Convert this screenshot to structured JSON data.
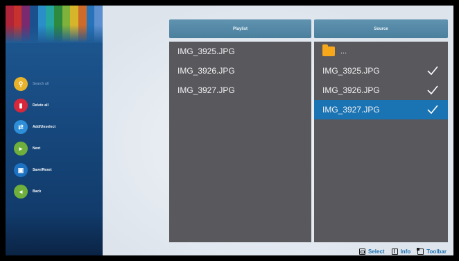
{
  "sidebar": {
    "stripe_colors": [
      "#b0243a",
      "#c8322e",
      "#7a2a6e",
      "#1b4f8d",
      "#2a8fc9",
      "#25a7a0",
      "#2d8a3e",
      "#7fb23a",
      "#d7b52b",
      "#cf6b2a",
      "#2673b9",
      "#5b8fd0"
    ],
    "items": [
      {
        "label": "Search all",
        "icon": "search-icon",
        "color": "#e8b32a",
        "dim": true
      },
      {
        "label": "Delete all",
        "icon": "delete-icon",
        "color": "#d6283a",
        "dim": false
      },
      {
        "label": "Add/Unselect",
        "icon": "add-icon",
        "color": "#2e8fd8",
        "dim": false
      },
      {
        "label": "Next",
        "icon": "next-icon",
        "color": "#6fb03c",
        "dim": false
      },
      {
        "label": "Save/Reset",
        "icon": "save-icon",
        "color": "#1e72c2",
        "dim": false
      },
      {
        "label": "Back",
        "icon": "back-icon",
        "color": "#6fb03c",
        "dim": false
      }
    ]
  },
  "playlist": {
    "header": "Playlist",
    "items": [
      "IMG_3925.JPG",
      "IMG_3926.JPG",
      "IMG_3927.JPG"
    ]
  },
  "source": {
    "header": "Source",
    "parent_label": "...",
    "items": [
      {
        "name": "IMG_3925.JPG",
        "checked": true,
        "selected": false
      },
      {
        "name": "IMG_3926.JPG",
        "checked": true,
        "selected": false
      },
      {
        "name": "IMG_3927.JPG",
        "checked": true,
        "selected": true
      }
    ]
  },
  "footer": {
    "select_label": "Select",
    "info_label": "Info",
    "toolbar_label": "Toolbar"
  },
  "colors": {
    "selected_row": "#1a73b3",
    "panel": "#58585d",
    "header": "#4a7f9d",
    "folder": "#f7a81a"
  }
}
